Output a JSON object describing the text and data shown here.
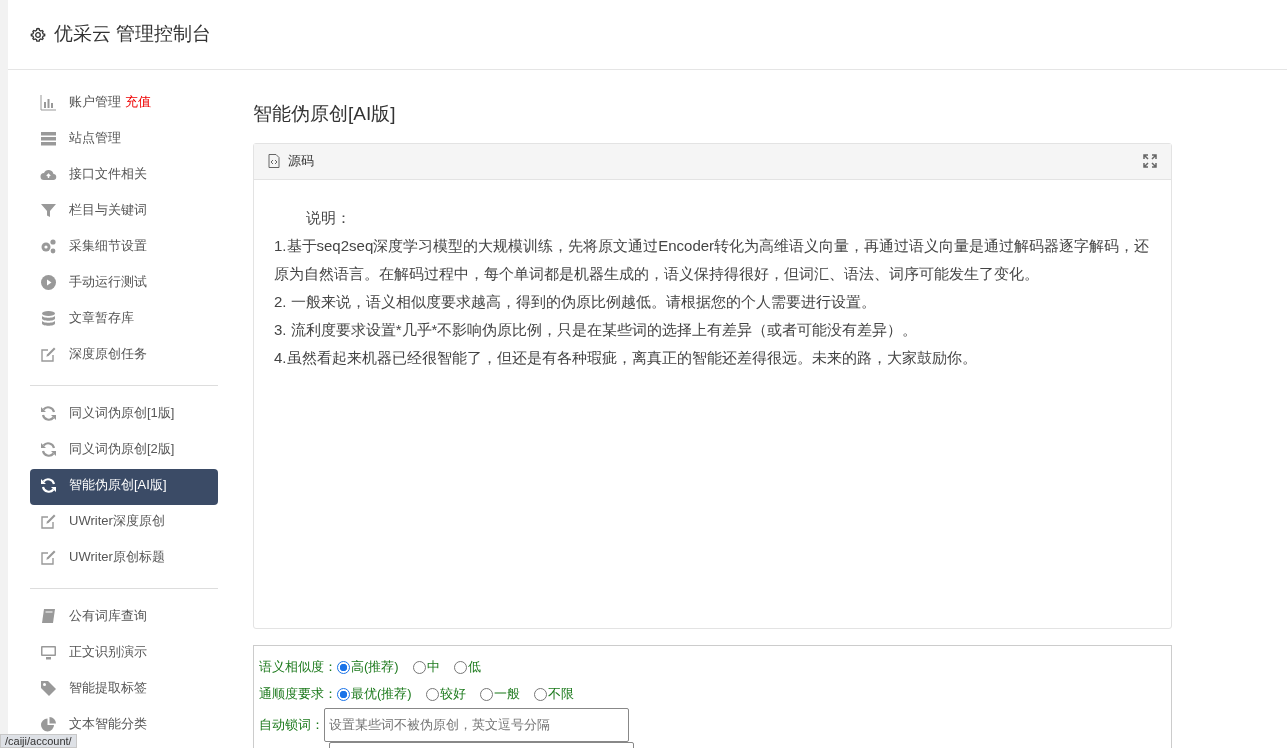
{
  "header": {
    "title": "优采云 管理控制台"
  },
  "sidebar": {
    "groups": [
      {
        "items": [
          {
            "label": "账户管理",
            "tag": "充值",
            "selected": false
          },
          {
            "label": "站点管理",
            "selected": false
          },
          {
            "label": "接口文件相关",
            "selected": false
          },
          {
            "label": "栏目与关键词",
            "selected": false
          },
          {
            "label": "采集细节设置",
            "selected": false
          },
          {
            "label": "手动运行测试",
            "selected": false
          },
          {
            "label": "文章暂存库",
            "selected": false
          },
          {
            "label": "深度原创任务",
            "selected": false
          }
        ]
      },
      {
        "items": [
          {
            "label": "同义词伪原创[1版]",
            "selected": false
          },
          {
            "label": "同义词伪原创[2版]",
            "selected": false
          },
          {
            "label": "智能伪原创[AI版]",
            "selected": true
          },
          {
            "label": "UWriter深度原创",
            "selected": false
          },
          {
            "label": "UWriter原创标题",
            "selected": false
          }
        ]
      },
      {
        "items": [
          {
            "label": "公有词库查询",
            "selected": false
          },
          {
            "label": "正文识别演示",
            "selected": false
          },
          {
            "label": "智能提取标签",
            "selected": false
          },
          {
            "label": "文本智能分类",
            "selected": false
          }
        ]
      }
    ]
  },
  "main": {
    "title": "智能伪原创[AI版]",
    "source_card": {
      "header": "源码",
      "heading": "说明：",
      "paragraphs": [
        "1.基于seq2seq深度学习模型的大规模训练，先将原文通过Encoder转化为高维语义向量，再通过语义向量是通过解码器逐字解码，还原为自然语言。在解码过程中，每个单词都是机器生成的，语义保持得很好，但词汇、语法、词序可能发生了变化。",
        "2. 一般来说，语义相似度要求越高，得到的伪原比例越低。请根据您的个人需要进行设置。",
        "3. 流利度要求设置*几乎*不影响伪原比例，只是在某些词的选择上有差异（或者可能没有差异）。",
        "4.虽然看起来机器已经很智能了，但还是有各种瑕疵，离真正的智能还差得很远。未来的路，大家鼓励你。"
      ]
    },
    "form": [
      {
        "kind": "radio",
        "label": "语义相似度：",
        "options": [
          {
            "label": "高(推荐)",
            "selected": true
          },
          {
            "label": "中",
            "selected": false
          },
          {
            "label": "低",
            "selected": false
          }
        ]
      },
      {
        "kind": "radio",
        "label": "通顺度要求：",
        "options": [
          {
            "label": "最优(推荐)",
            "selected": true
          },
          {
            "label": "较好",
            "selected": false
          },
          {
            "label": "一般",
            "selected": false
          },
          {
            "label": "不限",
            "selected": false
          }
        ]
      },
      {
        "kind": "text",
        "label": "自动锁词：",
        "placeholder": "设置某些词不被伪原创，英文逗号分隔"
      },
      {
        "kind": "text"
      }
    ]
  },
  "status_url": "/caiji/account/"
}
